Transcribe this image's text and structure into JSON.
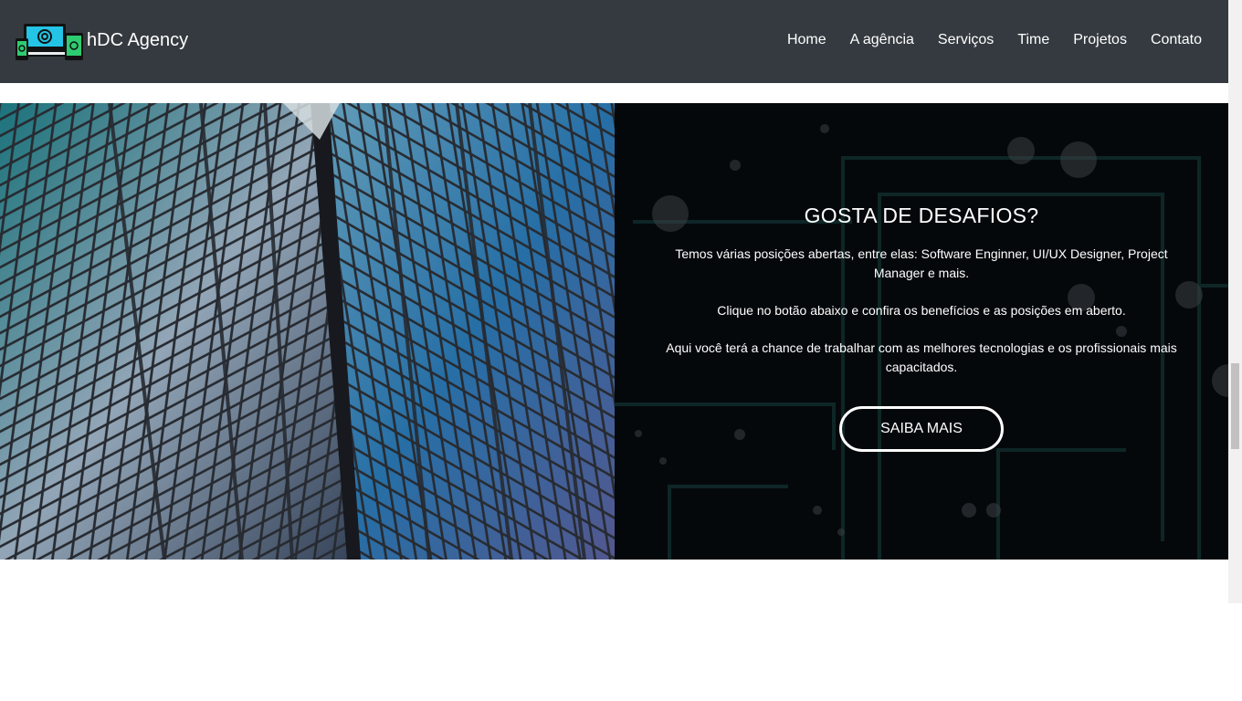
{
  "navbar": {
    "brand": "hDC Agency",
    "links": [
      "Home",
      "A agência",
      "Serviços",
      "Time",
      "Projetos",
      "Contato"
    ]
  },
  "hero": {
    "title": "GOSTA DE DESAFIOS?",
    "paragraphs": [
      "Temos várias posições abertas, entre elas: Software Enginner, UI/UX Designer, Project Manager e mais.",
      "Clique no botão abaixo e confira os benefícios e as posições em aberto.",
      "Aqui você terá a chance de trabalhar com as melhores tecnologias e os profissionais mais capacitados."
    ],
    "button": "SAIBA MAIS"
  },
  "colors": {
    "navbar_bg": "#343a40",
    "panel_bg": "#05080b",
    "accent": "#19b5c9"
  },
  "icons": {
    "brand_logo": "devices-logo-icon"
  }
}
